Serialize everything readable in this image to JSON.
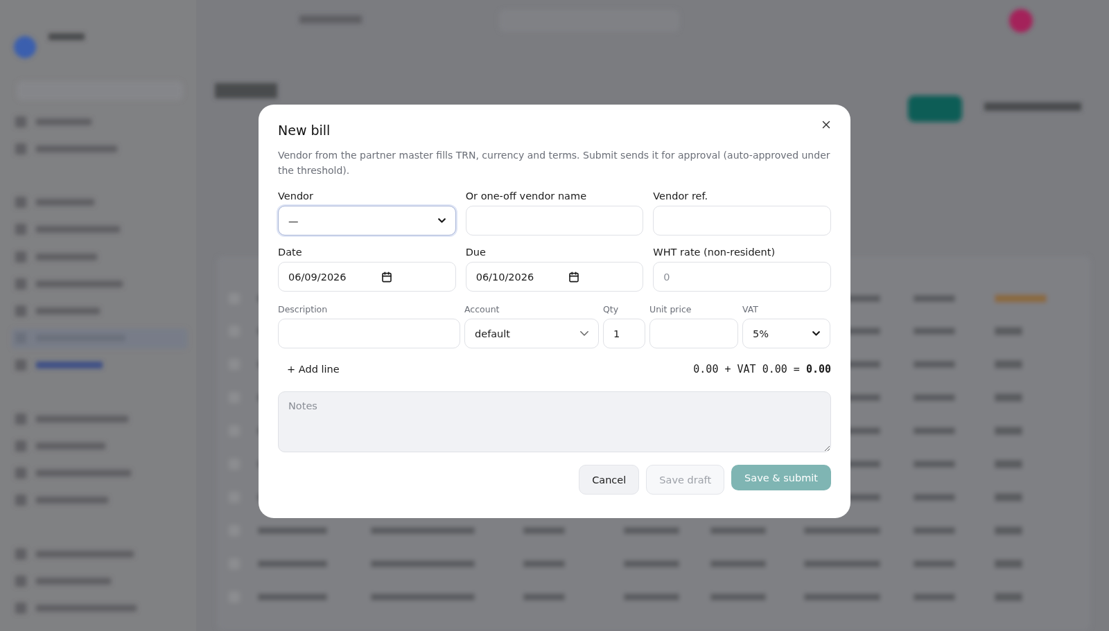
{
  "dialog": {
    "title": "New bill",
    "description": "Vendor from the partner master fills TRN, currency and terms. Submit sends it for approval (auto-approved under the threshold).",
    "header_fields": [
      {
        "kind": "select",
        "label": "Vendor",
        "value": "—",
        "focused": true
      },
      {
        "kind": "text",
        "label": "Or one-off vendor name",
        "focused": false
      },
      {
        "kind": "text",
        "label": "Vendor ref.",
        "focused": false
      },
      {
        "kind": "date",
        "label": "Date",
        "value": "06/09/2026",
        "focused": false
      },
      {
        "kind": "date",
        "label": "Due",
        "value": "06/10/2026",
        "focused": false
      },
      {
        "kind": "text",
        "label": "WHT rate (non-resident)",
        "placeholder": "0",
        "focused": false
      }
    ],
    "line_columns": [
      "Description",
      "Account",
      "Qty",
      "Unit price",
      "VAT"
    ],
    "line": [
      {
        "kind": "text"
      },
      {
        "kind": "combo",
        "value": "default"
      },
      {
        "kind": "text",
        "value": "1"
      },
      {
        "kind": "text"
      },
      {
        "kind": "select",
        "value": "5%"
      }
    ],
    "add_line": "+ Add line",
    "totals": {
      "net": "0.00",
      "vat_label": "+ VAT",
      "vat": "0.00",
      "equals": "=",
      "total": "0.00"
    },
    "notes": {
      "placeholder": "Notes"
    },
    "buttons": [
      {
        "kind": "secondary",
        "label": "Cancel",
        "disabled": false
      },
      {
        "kind": "secondary",
        "label": "Save draft",
        "disabled": true
      },
      {
        "kind": "primary",
        "label": "Save & submit",
        "disabled": true
      }
    ]
  }
}
